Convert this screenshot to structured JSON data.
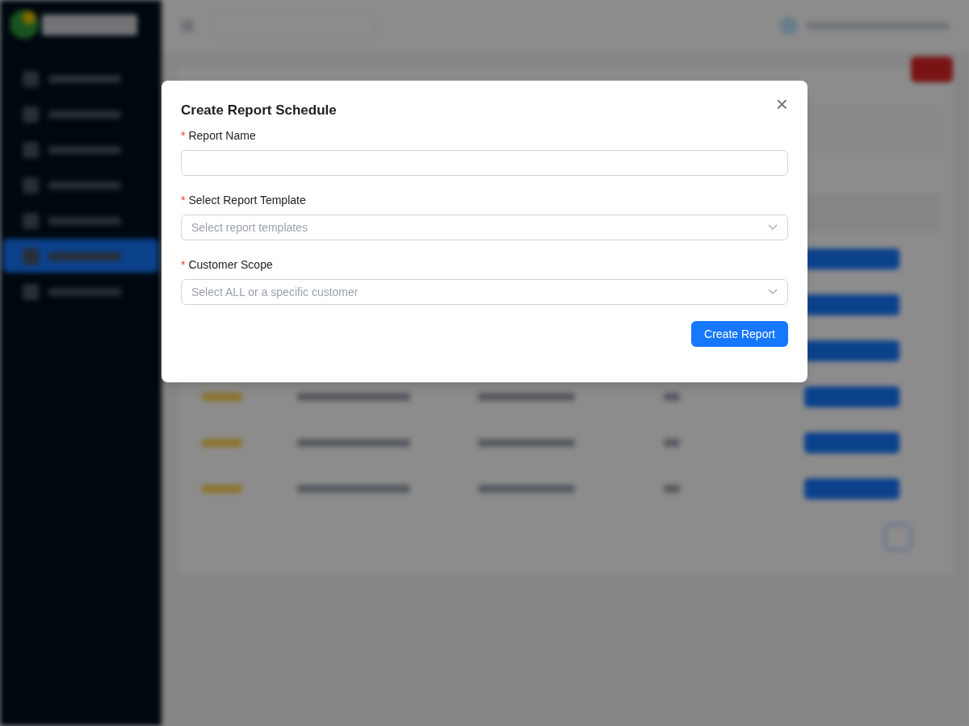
{
  "dialog": {
    "title": "Create Report Schedule",
    "close": "×",
    "required_mark": "*",
    "fields": [
      {
        "kind": "input",
        "label": "Report Name",
        "required": true
      },
      {
        "kind": "select",
        "label": "Select Report Template",
        "required": true,
        "placeholder": "Select report templates"
      },
      {
        "kind": "select",
        "label": "Customer Scope",
        "required": true,
        "placeholder": "Select ALL or a specific customer"
      }
    ],
    "submit": "Create Report"
  }
}
